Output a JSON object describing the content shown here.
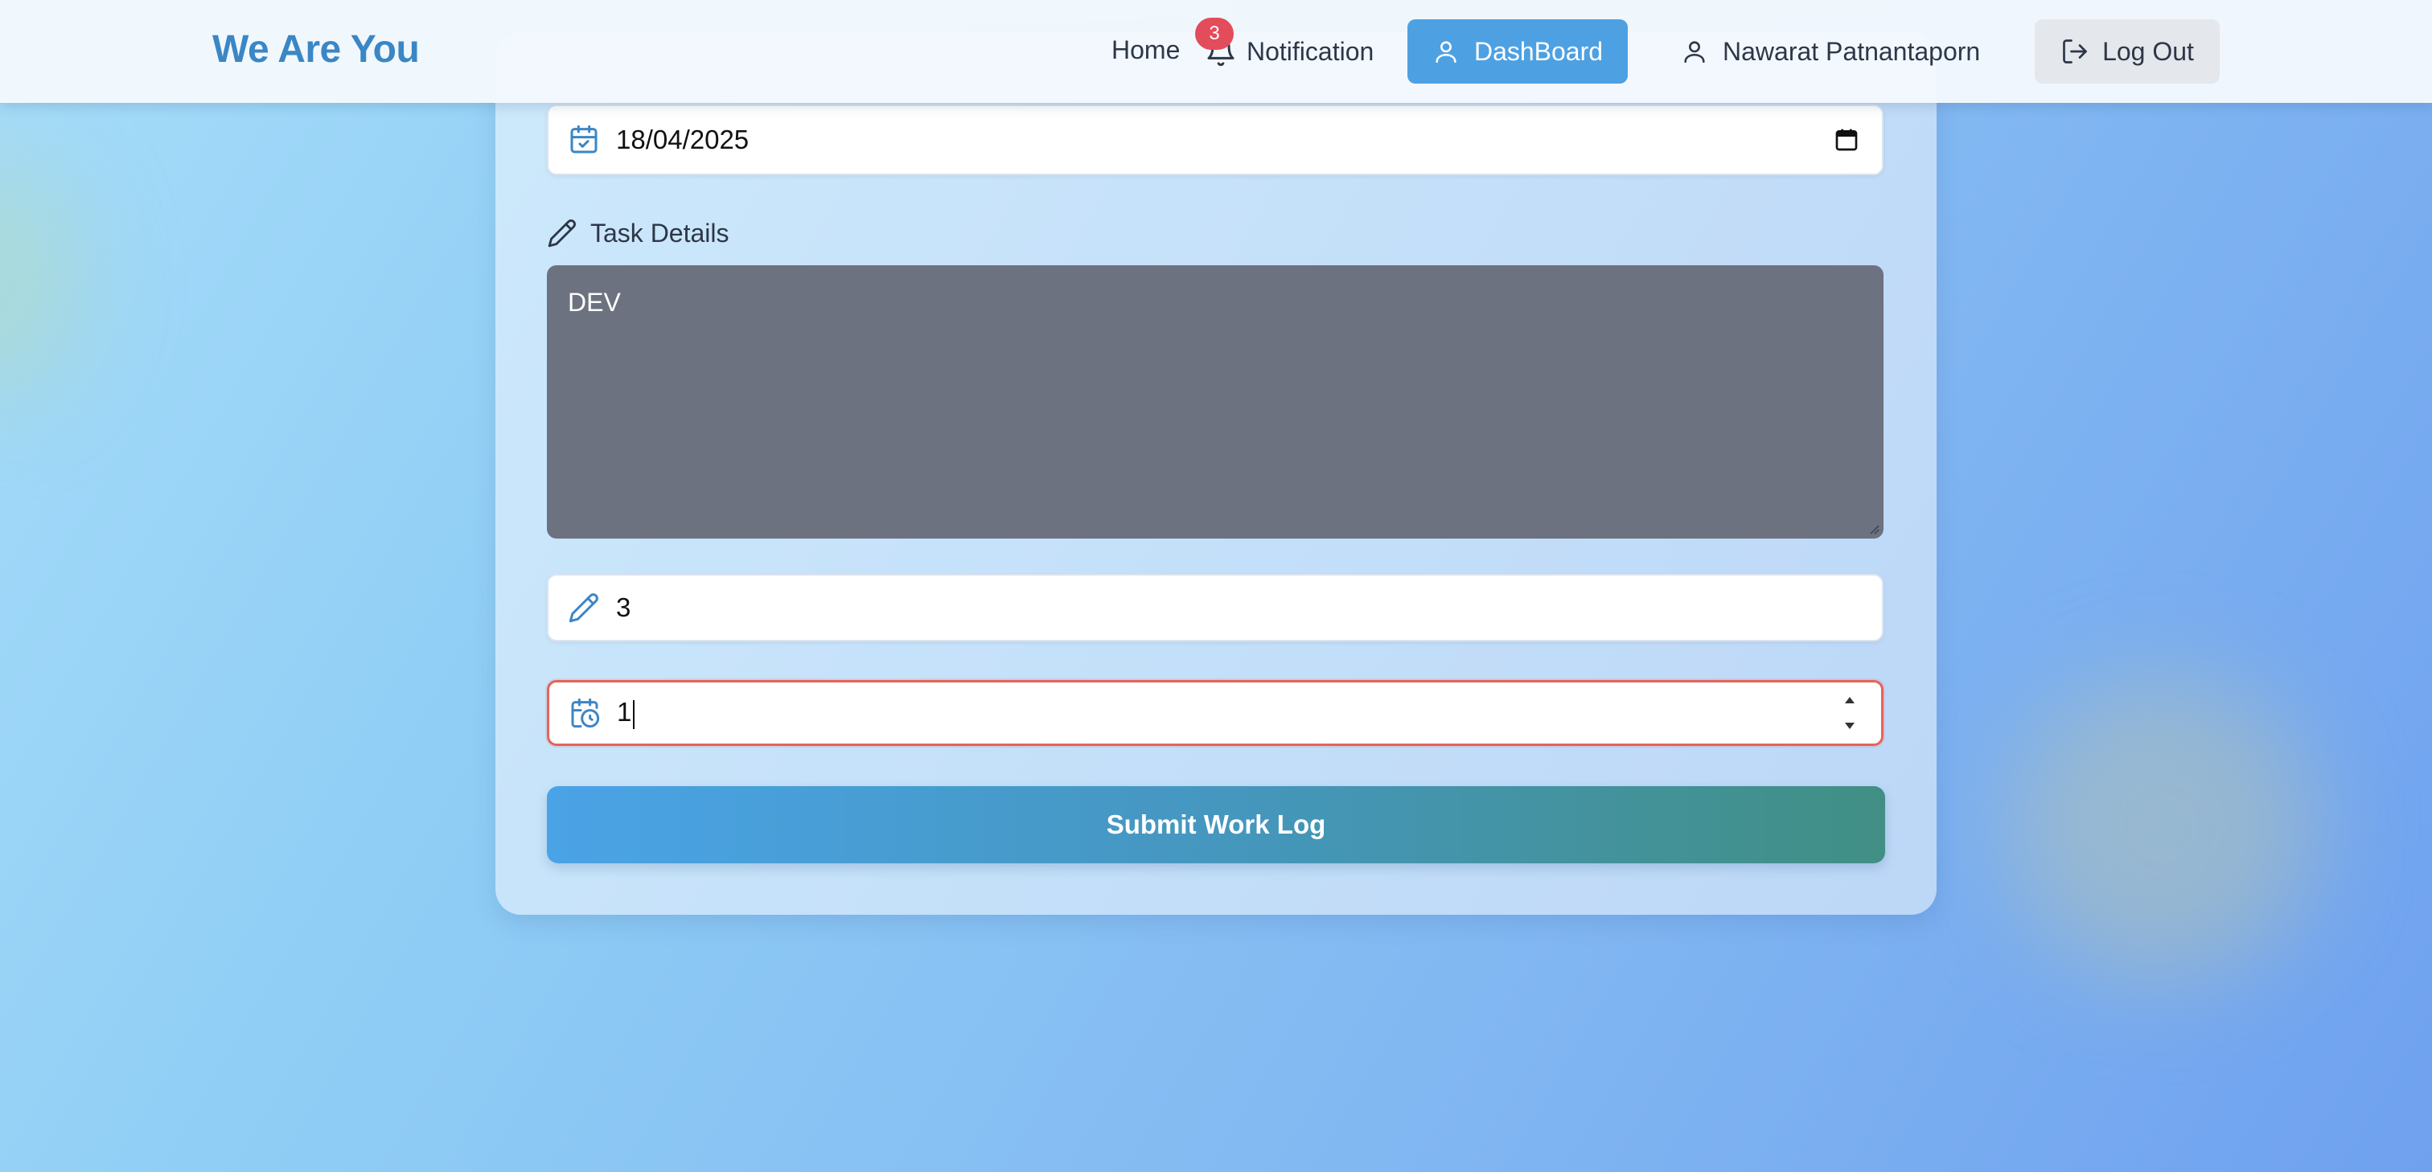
{
  "nav": {
    "brand": "We Are You",
    "home": "Home",
    "notification_label": "Notification",
    "notification_count": "3",
    "dashboard": "DashBoard",
    "user_name": "Nawarat Patnantaporn",
    "logout": "Log Out"
  },
  "form": {
    "date_value": "18/04/2025",
    "task_details_label": "Task Details",
    "task_details_value": "DEV",
    "hours_value": "3",
    "number_value": "1",
    "submit_label": "Submit Work Log"
  },
  "colors": {
    "brand": "#3b86c5",
    "primary": "#4da1e2",
    "badge": "#e24c5b",
    "error_border": "#e3645a"
  },
  "icons": [
    "bell-icon",
    "user-icon",
    "logout-icon",
    "calendar-check-icon",
    "pencil-icon",
    "calendar-clock-icon",
    "calendar-picker-icon"
  ]
}
